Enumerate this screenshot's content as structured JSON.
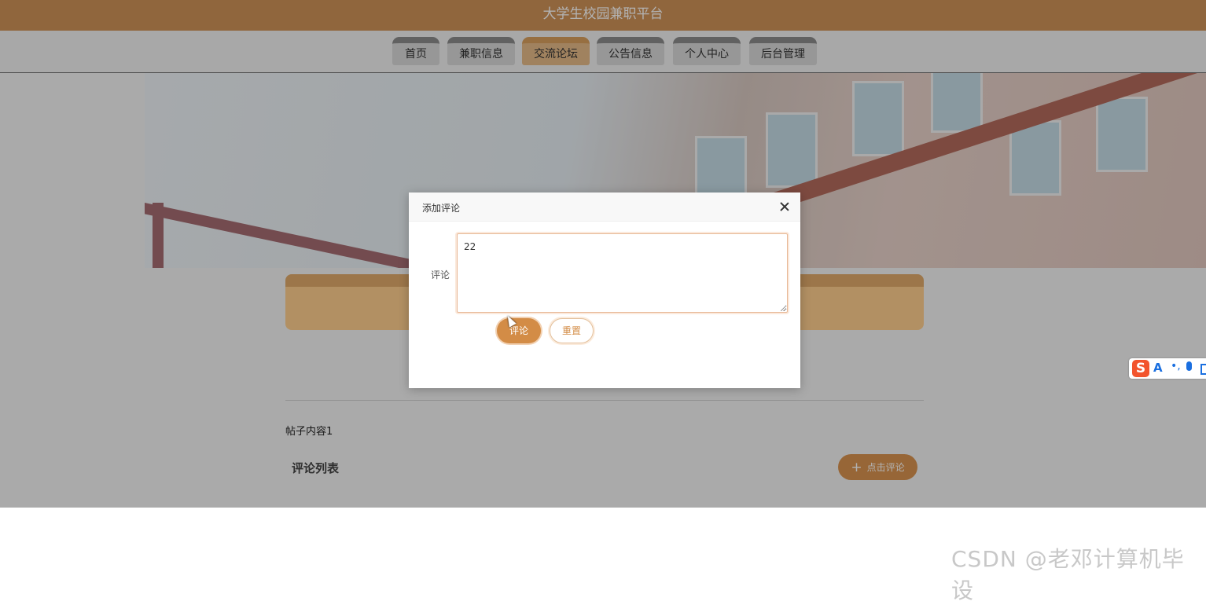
{
  "site": {
    "title": "大学生校园兼职平台"
  },
  "nav": {
    "items": [
      {
        "label": "首页"
      },
      {
        "label": "兼职信息"
      },
      {
        "label": "交流论坛"
      },
      {
        "label": "公告信息"
      },
      {
        "label": "个人中心"
      },
      {
        "label": "后台管理"
      }
    ],
    "active": "交流论坛"
  },
  "post": {
    "content": "帖子内容1",
    "comments_title": "评论列表",
    "add_comment_label": "点击评论"
  },
  "dialog": {
    "title": "添加评论",
    "field_label": "评论",
    "comment_value": "22",
    "submit_label": "评论",
    "reset_label": "重置"
  },
  "ime": {
    "letter": "A",
    "punct": "•,"
  },
  "watermark": "CSDN @老邓计算机毕设",
  "colors": {
    "brand": "#cf9258",
    "accent": "#d38c46",
    "nav_active": "#e6bb89"
  }
}
